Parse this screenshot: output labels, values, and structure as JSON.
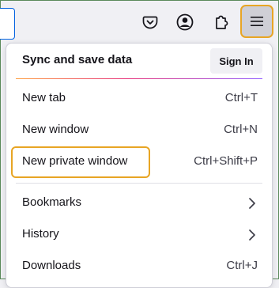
{
  "toolbar": {
    "icons": [
      "pocket-icon",
      "account-icon",
      "extensions-icon",
      "hamburger-menu-icon"
    ]
  },
  "menu": {
    "sync_label": "Sync and save data",
    "sign_in_label": "Sign In",
    "items": [
      {
        "label": "New tab",
        "shortcut": "Ctrl+T"
      },
      {
        "label": "New window",
        "shortcut": "Ctrl+N"
      },
      {
        "label": "New private window",
        "shortcut": "Ctrl+Shift+P"
      },
      {
        "label": "Bookmarks"
      },
      {
        "label": "History"
      },
      {
        "label": "Downloads",
        "shortcut": "Ctrl+J"
      }
    ]
  },
  "colors": {
    "focus_ring": "#e8a524",
    "accent": "#0061e0"
  }
}
